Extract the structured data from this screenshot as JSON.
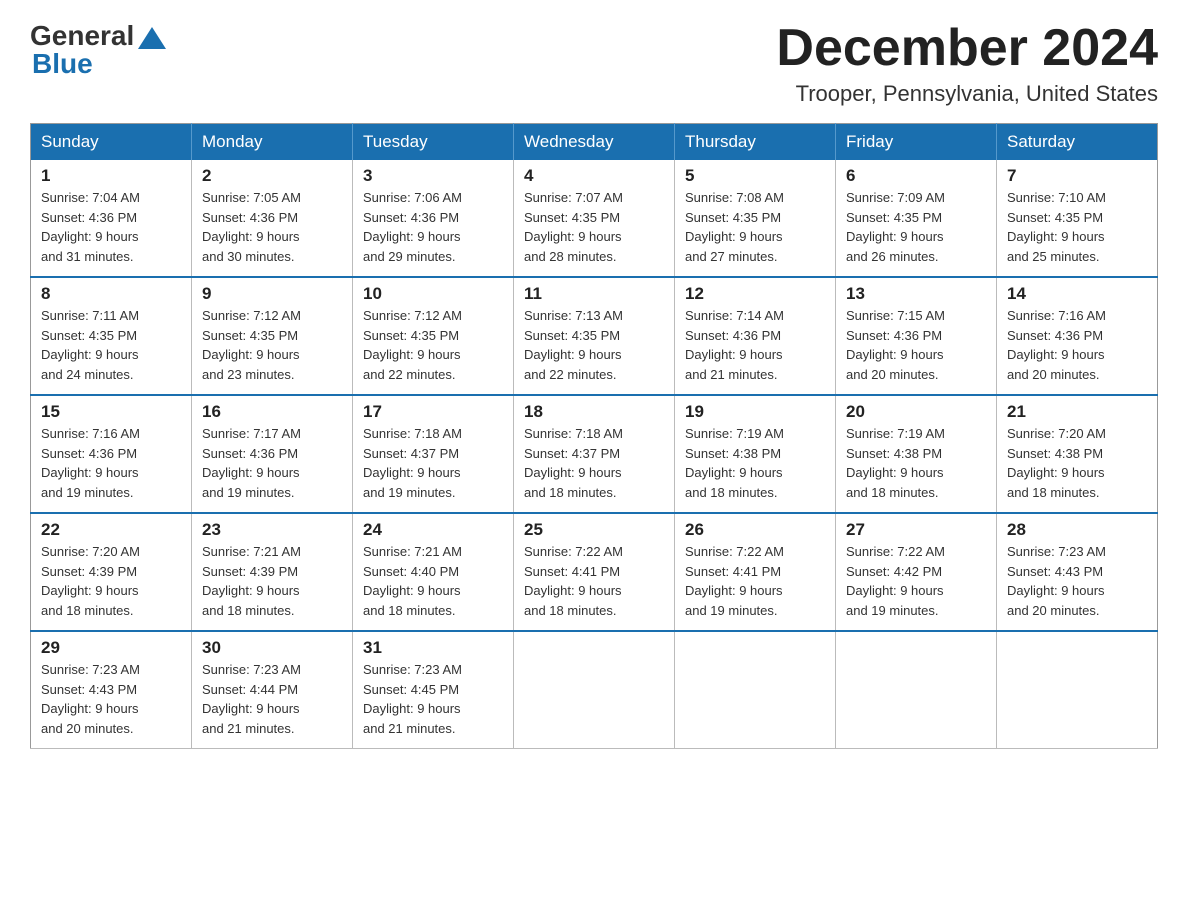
{
  "logo": {
    "general": "General",
    "blue": "Blue"
  },
  "title": {
    "month": "December 2024",
    "location": "Trooper, Pennsylvania, United States"
  },
  "weekdays": [
    "Sunday",
    "Monday",
    "Tuesday",
    "Wednesday",
    "Thursday",
    "Friday",
    "Saturday"
  ],
  "weeks": [
    [
      {
        "day": "1",
        "sunrise": "7:04 AM",
        "sunset": "4:36 PM",
        "daylight": "9 hours and 31 minutes."
      },
      {
        "day": "2",
        "sunrise": "7:05 AM",
        "sunset": "4:36 PM",
        "daylight": "9 hours and 30 minutes."
      },
      {
        "day": "3",
        "sunrise": "7:06 AM",
        "sunset": "4:36 PM",
        "daylight": "9 hours and 29 minutes."
      },
      {
        "day": "4",
        "sunrise": "7:07 AM",
        "sunset": "4:35 PM",
        "daylight": "9 hours and 28 minutes."
      },
      {
        "day": "5",
        "sunrise": "7:08 AM",
        "sunset": "4:35 PM",
        "daylight": "9 hours and 27 minutes."
      },
      {
        "day": "6",
        "sunrise": "7:09 AM",
        "sunset": "4:35 PM",
        "daylight": "9 hours and 26 minutes."
      },
      {
        "day": "7",
        "sunrise": "7:10 AM",
        "sunset": "4:35 PM",
        "daylight": "9 hours and 25 minutes."
      }
    ],
    [
      {
        "day": "8",
        "sunrise": "7:11 AM",
        "sunset": "4:35 PM",
        "daylight": "9 hours and 24 minutes."
      },
      {
        "day": "9",
        "sunrise": "7:12 AM",
        "sunset": "4:35 PM",
        "daylight": "9 hours and 23 minutes."
      },
      {
        "day": "10",
        "sunrise": "7:12 AM",
        "sunset": "4:35 PM",
        "daylight": "9 hours and 22 minutes."
      },
      {
        "day": "11",
        "sunrise": "7:13 AM",
        "sunset": "4:35 PM",
        "daylight": "9 hours and 22 minutes."
      },
      {
        "day": "12",
        "sunrise": "7:14 AM",
        "sunset": "4:36 PM",
        "daylight": "9 hours and 21 minutes."
      },
      {
        "day": "13",
        "sunrise": "7:15 AM",
        "sunset": "4:36 PM",
        "daylight": "9 hours and 20 minutes."
      },
      {
        "day": "14",
        "sunrise": "7:16 AM",
        "sunset": "4:36 PM",
        "daylight": "9 hours and 20 minutes."
      }
    ],
    [
      {
        "day": "15",
        "sunrise": "7:16 AM",
        "sunset": "4:36 PM",
        "daylight": "9 hours and 19 minutes."
      },
      {
        "day": "16",
        "sunrise": "7:17 AM",
        "sunset": "4:36 PM",
        "daylight": "9 hours and 19 minutes."
      },
      {
        "day": "17",
        "sunrise": "7:18 AM",
        "sunset": "4:37 PM",
        "daylight": "9 hours and 19 minutes."
      },
      {
        "day": "18",
        "sunrise": "7:18 AM",
        "sunset": "4:37 PM",
        "daylight": "9 hours and 18 minutes."
      },
      {
        "day": "19",
        "sunrise": "7:19 AM",
        "sunset": "4:38 PM",
        "daylight": "9 hours and 18 minutes."
      },
      {
        "day": "20",
        "sunrise": "7:19 AM",
        "sunset": "4:38 PM",
        "daylight": "9 hours and 18 minutes."
      },
      {
        "day": "21",
        "sunrise": "7:20 AM",
        "sunset": "4:38 PM",
        "daylight": "9 hours and 18 minutes."
      }
    ],
    [
      {
        "day": "22",
        "sunrise": "7:20 AM",
        "sunset": "4:39 PM",
        "daylight": "9 hours and 18 minutes."
      },
      {
        "day": "23",
        "sunrise": "7:21 AM",
        "sunset": "4:39 PM",
        "daylight": "9 hours and 18 minutes."
      },
      {
        "day": "24",
        "sunrise": "7:21 AM",
        "sunset": "4:40 PM",
        "daylight": "9 hours and 18 minutes."
      },
      {
        "day": "25",
        "sunrise": "7:22 AM",
        "sunset": "4:41 PM",
        "daylight": "9 hours and 18 minutes."
      },
      {
        "day": "26",
        "sunrise": "7:22 AM",
        "sunset": "4:41 PM",
        "daylight": "9 hours and 19 minutes."
      },
      {
        "day": "27",
        "sunrise": "7:22 AM",
        "sunset": "4:42 PM",
        "daylight": "9 hours and 19 minutes."
      },
      {
        "day": "28",
        "sunrise": "7:23 AM",
        "sunset": "4:43 PM",
        "daylight": "9 hours and 20 minutes."
      }
    ],
    [
      {
        "day": "29",
        "sunrise": "7:23 AM",
        "sunset": "4:43 PM",
        "daylight": "9 hours and 20 minutes."
      },
      {
        "day": "30",
        "sunrise": "7:23 AM",
        "sunset": "4:44 PM",
        "daylight": "9 hours and 21 minutes."
      },
      {
        "day": "31",
        "sunrise": "7:23 AM",
        "sunset": "4:45 PM",
        "daylight": "9 hours and 21 minutes."
      },
      null,
      null,
      null,
      null
    ]
  ],
  "labels": {
    "sunrise": "Sunrise:",
    "sunset": "Sunset:",
    "daylight": "Daylight:"
  }
}
